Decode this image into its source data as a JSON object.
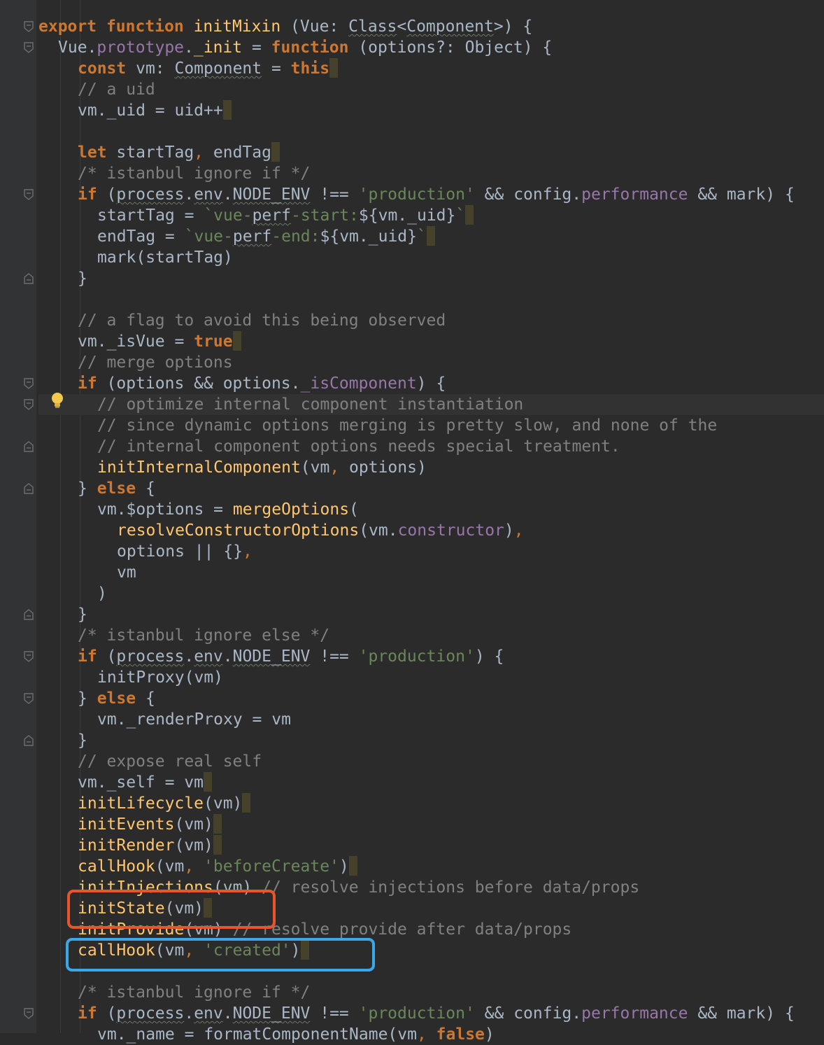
{
  "editor": {
    "lines": [
      {
        "indent": 0,
        "fold": "open",
        "tokens": [
          [
            "k",
            "export "
          ],
          [
            "k",
            "function "
          ],
          [
            "fn",
            "initMixin"
          ],
          [
            "id",
            " (Vue: "
          ],
          [
            "u",
            "Class"
          ],
          [
            "id",
            "<"
          ],
          [
            "u",
            "Component"
          ],
          [
            "id",
            ">) {"
          ]
        ]
      },
      {
        "indent": 1,
        "fold": "open",
        "tokens": [
          [
            "id",
            "Vue."
          ],
          [
            "pr",
            "prototype"
          ],
          [
            "id",
            "."
          ],
          [
            "fn",
            "_init"
          ],
          [
            "id",
            " = "
          ],
          [
            "k",
            "function "
          ],
          [
            "id",
            "(options?: Object) {"
          ]
        ]
      },
      {
        "indent": 2,
        "caret": true,
        "tokens": [
          [
            "k",
            "const "
          ],
          [
            "id",
            "vm: "
          ],
          [
            "u",
            "Component"
          ],
          [
            "id",
            " = "
          ],
          [
            "k",
            "this"
          ]
        ]
      },
      {
        "indent": 2,
        "tokens": [
          [
            "c",
            "// a uid"
          ]
        ]
      },
      {
        "indent": 2,
        "caret": true,
        "tokens": [
          [
            "id",
            "vm._uid = uid++"
          ]
        ]
      },
      {
        "indent": 2,
        "tokens": []
      },
      {
        "indent": 2,
        "caret": true,
        "tokens": [
          [
            "k",
            "let "
          ],
          [
            "id",
            "startTag"
          ],
          [
            "p",
            ", "
          ],
          [
            "id",
            "endTag"
          ]
        ]
      },
      {
        "indent": 2,
        "tokens": [
          [
            "c",
            "/* istanbul ignore if */"
          ]
        ]
      },
      {
        "indent": 2,
        "fold": "open",
        "tokens": [
          [
            "k",
            "if "
          ],
          [
            "id",
            "("
          ],
          [
            "u",
            "process"
          ],
          [
            "id",
            "."
          ],
          [
            "u",
            "env"
          ],
          [
            "id",
            "."
          ],
          [
            "u",
            "NODE_ENV"
          ],
          [
            "id",
            " !== "
          ],
          [
            "s",
            "'production'"
          ],
          [
            "id",
            " && config."
          ],
          [
            "pr",
            "performance"
          ],
          [
            "id",
            " && mark) {"
          ]
        ]
      },
      {
        "indent": 3,
        "caret": true,
        "tokens": [
          [
            "id",
            "startTag = "
          ],
          [
            "s",
            "`vue-"
          ],
          [
            "u",
            "perf"
          ],
          [
            "s",
            "-start:"
          ],
          [
            "id",
            "${vm._uid}"
          ],
          [
            "s",
            "`"
          ]
        ]
      },
      {
        "indent": 3,
        "caret": true,
        "tokens": [
          [
            "id",
            "endTag = "
          ],
          [
            "s",
            "`vue-"
          ],
          [
            "u",
            "perf"
          ],
          [
            "s",
            "-end:"
          ],
          [
            "id",
            "${vm._uid}"
          ],
          [
            "s",
            "`"
          ]
        ]
      },
      {
        "indent": 3,
        "tokens": [
          [
            "id",
            "mark(startTag)"
          ]
        ]
      },
      {
        "indent": 2,
        "fold": "close",
        "tokens": [
          [
            "id",
            "}"
          ]
        ]
      },
      {
        "indent": 2,
        "tokens": []
      },
      {
        "indent": 2,
        "tokens": [
          [
            "c",
            "// a flag to avoid this being observed"
          ]
        ]
      },
      {
        "indent": 2,
        "caret": true,
        "tokens": [
          [
            "id",
            "vm._isVue = "
          ],
          [
            "k",
            "true"
          ]
        ]
      },
      {
        "indent": 2,
        "tokens": [
          [
            "c",
            "// merge options"
          ]
        ]
      },
      {
        "indent": 2,
        "fold": "open",
        "tokens": [
          [
            "k",
            "if "
          ],
          [
            "id",
            "(options && options."
          ],
          [
            "pr",
            "_isComponent"
          ],
          [
            "id",
            ") {"
          ]
        ]
      },
      {
        "indent": 3,
        "fold": "open",
        "current": true,
        "tokens": [
          [
            "c",
            "// optimize internal component instantiation"
          ]
        ]
      },
      {
        "indent": 3,
        "tokens": [
          [
            "c",
            "// since dynamic options merging is pretty slow, and none of the"
          ]
        ]
      },
      {
        "indent": 3,
        "fold": "close",
        "tokens": [
          [
            "c",
            "// internal component options needs special treatment."
          ]
        ]
      },
      {
        "indent": 3,
        "tokens": [
          [
            "fn",
            "initInternalComponent"
          ],
          [
            "id",
            "(vm"
          ],
          [
            "p",
            ", "
          ],
          [
            "id",
            "options)"
          ]
        ]
      },
      {
        "indent": 2,
        "fold": "close",
        "tokens": [
          [
            "id",
            "} "
          ],
          [
            "k",
            "else "
          ],
          [
            "id",
            "{"
          ]
        ]
      },
      {
        "indent": 3,
        "tokens": [
          [
            "id",
            "vm.$options = "
          ],
          [
            "fn",
            "mergeOptions"
          ],
          [
            "id",
            "("
          ]
        ]
      },
      {
        "indent": 4,
        "tokens": [
          [
            "fn",
            "resolveConstructorOptions"
          ],
          [
            "id",
            "(vm."
          ],
          [
            "pr",
            "constructor"
          ],
          [
            "id",
            ")"
          ],
          [
            "p",
            ","
          ]
        ]
      },
      {
        "indent": 4,
        "tokens": [
          [
            "id",
            "options || {}"
          ],
          [
            "p",
            ","
          ]
        ]
      },
      {
        "indent": 4,
        "tokens": [
          [
            "id",
            "vm"
          ]
        ]
      },
      {
        "indent": 3,
        "tokens": [
          [
            "id",
            ")"
          ]
        ]
      },
      {
        "indent": 2,
        "fold": "close",
        "tokens": [
          [
            "id",
            "}"
          ]
        ]
      },
      {
        "indent": 2,
        "tokens": [
          [
            "c",
            "/* istanbul ignore else */"
          ]
        ]
      },
      {
        "indent": 2,
        "fold": "open",
        "tokens": [
          [
            "k",
            "if "
          ],
          [
            "id",
            "("
          ],
          [
            "u",
            "process"
          ],
          [
            "id",
            "."
          ],
          [
            "u",
            "env"
          ],
          [
            "id",
            "."
          ],
          [
            "u",
            "NODE_ENV"
          ],
          [
            "id",
            " !== "
          ],
          [
            "s",
            "'production'"
          ],
          [
            "id",
            ") {"
          ]
        ]
      },
      {
        "indent": 3,
        "tokens": [
          [
            "id",
            "initProxy(vm)"
          ]
        ]
      },
      {
        "indent": 2,
        "fold": "open",
        "tokens": [
          [
            "id",
            "} "
          ],
          [
            "k",
            "else "
          ],
          [
            "id",
            "{"
          ]
        ]
      },
      {
        "indent": 3,
        "tokens": [
          [
            "id",
            "vm._renderProxy = vm"
          ]
        ]
      },
      {
        "indent": 2,
        "fold": "close",
        "tokens": [
          [
            "id",
            "}"
          ]
        ]
      },
      {
        "indent": 2,
        "tokens": [
          [
            "c",
            "// expose real self"
          ]
        ]
      },
      {
        "indent": 2,
        "caret": true,
        "tokens": [
          [
            "id",
            "vm._self = vm"
          ]
        ]
      },
      {
        "indent": 2,
        "caret": true,
        "tokens": [
          [
            "fn",
            "initLifecycle"
          ],
          [
            "id",
            "(vm)"
          ]
        ]
      },
      {
        "indent": 2,
        "caret": true,
        "tokens": [
          [
            "fn",
            "initEvents"
          ],
          [
            "id",
            "(vm)"
          ]
        ]
      },
      {
        "indent": 2,
        "caret": true,
        "tokens": [
          [
            "fn",
            "initRender"
          ],
          [
            "id",
            "(vm)"
          ]
        ]
      },
      {
        "indent": 2,
        "caret": true,
        "tokens": [
          [
            "fn",
            "callHook"
          ],
          [
            "id",
            "(vm"
          ],
          [
            "p",
            ", "
          ],
          [
            "s",
            "'beforeCreate'"
          ],
          [
            "id",
            ")"
          ]
        ]
      },
      {
        "indent": 2,
        "tokens": [
          [
            "fn",
            "initInjections"
          ],
          [
            "id",
            "(vm) "
          ],
          [
            "c",
            "// resolve injections before data/props"
          ]
        ]
      },
      {
        "indent": 2,
        "caret": true,
        "tokens": [
          [
            "fn",
            "initState"
          ],
          [
            "id",
            "(vm)"
          ]
        ]
      },
      {
        "indent": 2,
        "tokens": [
          [
            "fn",
            "initProvide"
          ],
          [
            "id",
            "(vm) "
          ],
          [
            "c",
            "// resolve provide after data/props"
          ]
        ]
      },
      {
        "indent": 2,
        "caret": true,
        "tokens": [
          [
            "fn",
            "callHook"
          ],
          [
            "id",
            "(vm"
          ],
          [
            "p",
            ", "
          ],
          [
            "s",
            "'created'"
          ],
          [
            "id",
            ")"
          ]
        ]
      },
      {
        "indent": 2,
        "tokens": []
      },
      {
        "indent": 2,
        "tokens": [
          [
            "c",
            "/* istanbul ignore if */"
          ]
        ]
      },
      {
        "indent": 2,
        "fold": "open",
        "tokens": [
          [
            "k",
            "if "
          ],
          [
            "id",
            "("
          ],
          [
            "u",
            "process"
          ],
          [
            "id",
            "."
          ],
          [
            "u",
            "env"
          ],
          [
            "id",
            "."
          ],
          [
            "u",
            "NODE_ENV"
          ],
          [
            "id",
            " !== "
          ],
          [
            "s",
            "'production'"
          ],
          [
            "id",
            " && config."
          ],
          [
            "pr",
            "performance"
          ],
          [
            "id",
            " && mark) {"
          ]
        ]
      },
      {
        "indent": 3,
        "tokens": [
          [
            "id",
            "vm._name = formatComponentName(vm"
          ],
          [
            "p",
            ", "
          ],
          [
            "k",
            "false"
          ],
          [
            "id",
            ")"
          ]
        ]
      }
    ]
  },
  "annotations": [
    {
      "label": "initState-highlight",
      "color": "#e8542c"
    },
    {
      "label": "created-hook-highlight",
      "color": "#3aa8e8"
    }
  ]
}
